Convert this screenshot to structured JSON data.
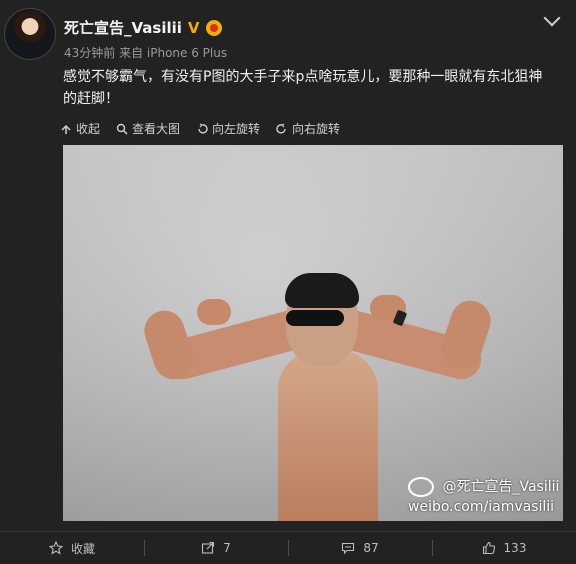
{
  "post": {
    "username": "死亡宣告_Vasilii",
    "vip_mark": "V",
    "meta": "43分钟前 来自 iPhone 6 Plus",
    "text": "感觉不够霸气，有没有P图的大手子来p点啥玩意儿，要那种一眼就有东北狙神的赶脚！"
  },
  "tools": {
    "collapse": "收起",
    "view_large": "查看大图",
    "rotate_left": "向左旋转",
    "rotate_right": "向右旋转"
  },
  "watermark": {
    "line1": "@死亡宣告_Vasilii",
    "line2": "weibo.com/iamvasilii"
  },
  "footer": {
    "favorite": "收藏",
    "repost_count": "7",
    "comment_count": "87",
    "like_count": "133"
  },
  "icons": {
    "favorite": "star-icon",
    "repost": "repost-icon",
    "comment": "comment-icon",
    "like": "thumb-up-icon"
  },
  "colors": {
    "accent": "#f7a900",
    "background": "#222222",
    "text": "#f0f0f0"
  }
}
